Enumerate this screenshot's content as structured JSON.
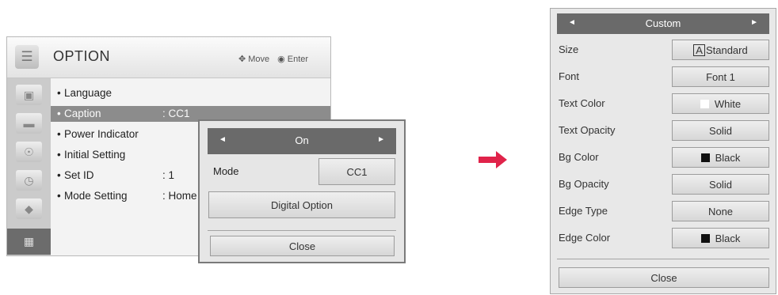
{
  "option_menu": {
    "title": "OPTION",
    "hint_move": "Move",
    "hint_enter": "Enter",
    "header_icon": "toolbox-icon",
    "categories": [
      {
        "icon": "picture-icon",
        "active": false
      },
      {
        "icon": "screen-icon",
        "active": false
      },
      {
        "icon": "sound-icon",
        "active": false
      },
      {
        "icon": "time-icon",
        "active": false
      },
      {
        "icon": "lock-icon",
        "active": false
      },
      {
        "icon": "option-icon",
        "active": true
      }
    ],
    "items": [
      {
        "bullet": "•",
        "label": "Language",
        "value": ""
      },
      {
        "bullet": "•",
        "label": "Caption",
        "value": ": CC1",
        "selected": true
      },
      {
        "bullet": "•",
        "label": "Power Indicator",
        "value": ""
      },
      {
        "bullet": "•",
        "label": "Initial Setting",
        "value": ""
      },
      {
        "bullet": "•",
        "label": "Set ID",
        "value": ": 1"
      },
      {
        "bullet": "•",
        "label": "Mode Setting",
        "value": ": Home"
      }
    ]
  },
  "caption_popup": {
    "selector": {
      "left": "◄",
      "value": "On",
      "right": "►"
    },
    "mode_label": "Mode",
    "mode_value": "CC1",
    "digital_option": "Digital Option",
    "close": "Close"
  },
  "custom_panel": {
    "selector": {
      "left": "◄",
      "value": "Custom",
      "right": "►"
    },
    "rows": [
      {
        "label": "Size",
        "prefix": "A",
        "value": "Standard",
        "swatch": ""
      },
      {
        "label": "Font",
        "value": "Font 1",
        "swatch": ""
      },
      {
        "label": "Text Color",
        "value": "White",
        "swatch": "white"
      },
      {
        "label": "Text Opacity",
        "value": "Solid",
        "swatch": ""
      },
      {
        "label": "Bg Color",
        "value": "Black",
        "swatch": "black"
      },
      {
        "label": "Bg Opacity",
        "value": "Solid",
        "swatch": ""
      },
      {
        "label": "Edge Type",
        "value": "None",
        "swatch": ""
      },
      {
        "label": "Edge Color",
        "value": "Black",
        "swatch": "black"
      }
    ],
    "close": "Close"
  },
  "colors": {
    "accent_arrow": "#e0234a",
    "highlight": "#8c8c8c",
    "dark_bar": "#6a6a6a"
  }
}
